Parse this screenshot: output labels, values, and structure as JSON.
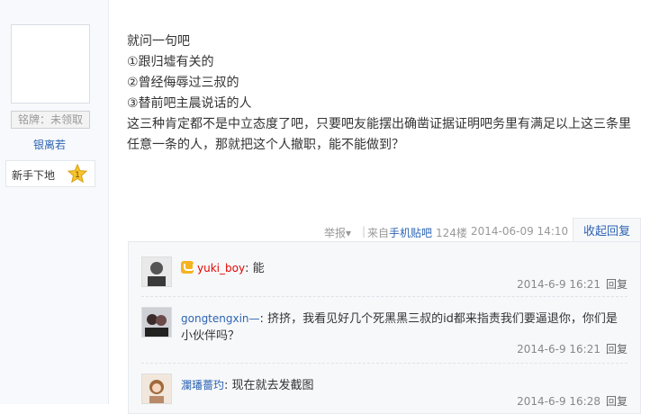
{
  "author": {
    "medal_label": "铭牌：未领取",
    "name": "银离若",
    "level_label": "新手下地",
    "level_number": "1"
  },
  "post": {
    "lines": [
      "就问一句吧",
      "①跟归墟有关的",
      "②曾经侮辱过三叔的",
      "③替前吧主晨说话的人",
      "这三种肯定都不是中立态度了吧，只要吧友能摆出确凿证据证明吧务里有满足以上这三条里",
      "任意一条的人，那就把这个人撤职，能不能做到？"
    ]
  },
  "post_tail": {
    "report": "举报",
    "sep": "|",
    "from_prefix": "来自",
    "from_link": "手机贴吧",
    "floor": "124楼",
    "time": "2014-06-09 14:10",
    "fold_reply": "收起回复"
  },
  "replies": [
    {
      "user": "yuki_boy",
      "colon": ":",
      "text": " 能",
      "time": "2014-6-9 16:21",
      "reply": "回复",
      "vip": true
    },
    {
      "user": "gongtengxin—",
      "colon": ":",
      "text": " 挤挤，我看见好几个死黑黑三叔的id都来指责我们要逼退你，你们是小伙伴吗？",
      "time": "2014-6-9 16:21",
      "reply": "回复",
      "vip": false
    },
    {
      "user": "瀾璠薔玓",
      "colon": ":",
      "text": " 现在就去发截图",
      "time": "2014-6-9 16:28",
      "reply": "回复",
      "vip": false
    }
  ],
  "colors": {
    "link": "#2d64b3",
    "username_vip": "#e10602",
    "meta": "#888888"
  }
}
